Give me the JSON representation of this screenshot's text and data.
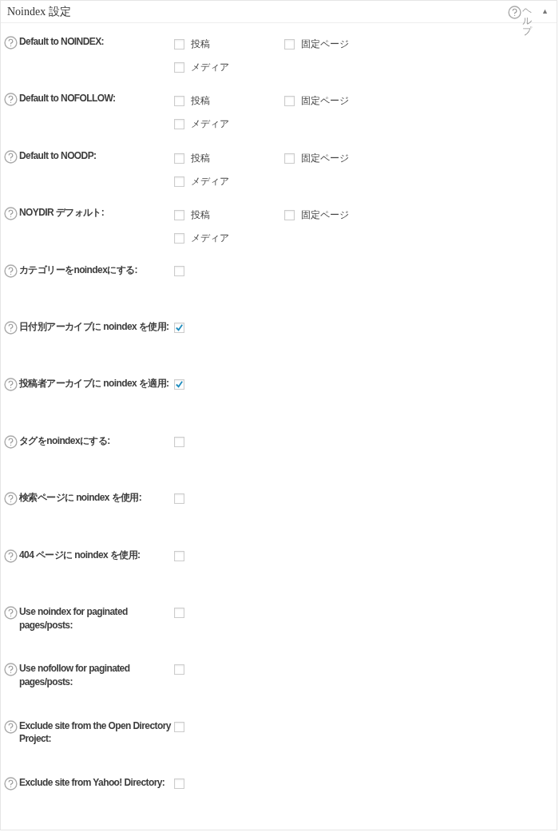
{
  "panel": {
    "title": "Noindex 設定",
    "help": "ヘルプ",
    "toggle": "▲"
  },
  "rows": [
    {
      "label": "Default to NOINDEX:",
      "kind": "multi",
      "options": [
        {
          "label": "投稿",
          "checked": false
        },
        {
          "label": "固定ページ",
          "checked": false
        },
        {
          "label": "メディア",
          "checked": false
        }
      ]
    },
    {
      "label": "Default to NOFOLLOW:",
      "kind": "multi",
      "options": [
        {
          "label": "投稿",
          "checked": false
        },
        {
          "label": "固定ページ",
          "checked": false
        },
        {
          "label": "メディア",
          "checked": false
        }
      ]
    },
    {
      "label": "Default to NOODP:",
      "kind": "multi",
      "options": [
        {
          "label": "投稿",
          "checked": false
        },
        {
          "label": "固定ページ",
          "checked": false
        },
        {
          "label": "メディア",
          "checked": false
        }
      ]
    },
    {
      "label": "NOYDIR デフォルト:",
      "kind": "multi",
      "options": [
        {
          "label": "投稿",
          "checked": false
        },
        {
          "label": "固定ページ",
          "checked": false
        },
        {
          "label": "メディア",
          "checked": false
        }
      ]
    },
    {
      "label": "カテゴリーをnoindexにする:",
      "kind": "single",
      "checked": false
    },
    {
      "label": "日付別アーカイブに noindex を使用:",
      "kind": "single",
      "checked": true
    },
    {
      "label": "投稿者アーカイブに noindex を適用:",
      "kind": "single",
      "checked": true
    },
    {
      "label": "タグをnoindexにする:",
      "kind": "single",
      "checked": false
    },
    {
      "label": "検索ページに noindex を使用:",
      "kind": "single",
      "checked": false
    },
    {
      "label": "404 ページに noindex を使用:",
      "kind": "single",
      "checked": false
    },
    {
      "label": "Use noindex for paginated pages/posts:",
      "kind": "single",
      "checked": false
    },
    {
      "label": "Use nofollow for paginated pages/posts:",
      "kind": "single",
      "checked": false
    },
    {
      "label": "Exclude site from the Open Directory Project:",
      "kind": "single",
      "checked": false
    },
    {
      "label": "Exclude site from Yahoo! Directory:",
      "kind": "single",
      "checked": false
    }
  ]
}
